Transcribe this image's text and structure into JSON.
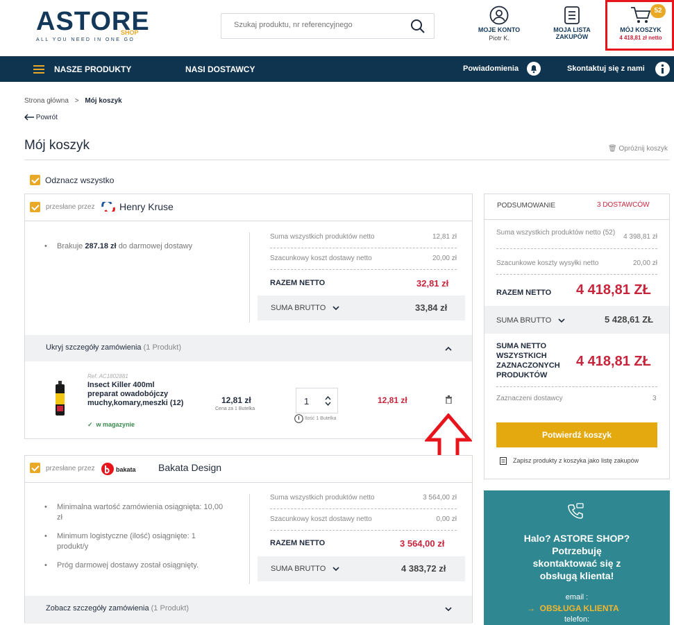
{
  "header": {
    "logo": "ASTORE",
    "logo_sub": "SHOP",
    "tagline": "ALL YOU NEED IN ONE GO",
    "search_placeholder": "Szukaj produktu, nr referencyjnego",
    "account_label": "MOJE KONTO",
    "account_user": "Piotr K.",
    "list_label_1": "MOJA LISTA",
    "list_label_2": "ZAKUPÓW",
    "cart_label": "MÓJ KOSZYK",
    "cart_total": "4 418,81 zł netto",
    "cart_count": "52"
  },
  "nav": {
    "products": "NASZE PRODUKTY",
    "suppliers": "NASI DOSTAWCY",
    "notifications": "Powiadomienia",
    "contact": "Skontaktuj się z nami"
  },
  "breadcrumb": {
    "home": "Strona główna",
    "sep": ">",
    "current": "Mój koszyk"
  },
  "back": "Powrót",
  "page_title": "Mój koszyk",
  "empty_cart": "Opróżnij koszyk",
  "deselect_all": "Odznacz wszystko",
  "sent_by": "przesłane przez",
  "supplier1": {
    "name": "Henry Kruse",
    "note_pre": "Brakuje",
    "note_amount": "287.18 zł",
    "note_post": "do darmowej dostawy",
    "sum_label": "Suma wszystkich produktów netto",
    "sum_value": "12,81 zł",
    "ship_label": "Szacunkowy koszt dostawy netto",
    "ship_value": "20,00 zł",
    "netto_label": "RAZEM NETTO",
    "netto_value": "32,81 zł",
    "brutto_label": "SUMA BRUTTO",
    "brutto_value": "33,84 zł",
    "details_label": "Ukryj szczegóły zamówienia",
    "details_count": "(1 Produkt)",
    "product": {
      "ref": "Ref. AC1802881",
      "name": "Insect Killer 400ml preparat owadobójczy muchy,komary,meszki (12)",
      "stock": "w magazynie",
      "price": "12,81 zł",
      "price_unit": "Cena za 1 Butelka",
      "qty": "1",
      "qty_note": "Ilość 1 Butelka",
      "total": "12,81 zł"
    }
  },
  "supplier2": {
    "name": "Bakata Design",
    "logo_text": "bakata",
    "notes": [
      "Minimalna wartość zamówienia osiągnięta: 10,00 zł",
      "Minimum logistyczne (ilość) osiągnięte: 1 produkt/y",
      "Próg darmowej dostawy został osiągnięty."
    ],
    "sum_label": "Suma wszystkich produktów netto",
    "sum_value": "3 564,00 zł",
    "ship_label": "Szacunkowy koszt dostawy netto",
    "ship_value": "0,00 zł",
    "netto_label": "RAZEM NETTO",
    "netto_value": "3 564,00 zł",
    "brutto_label": "SUMA BRUTTO",
    "brutto_value": "4 383,72 zł",
    "details_label": "Zobacz szczegóły zamówienia",
    "details_count": "(1 Produkt)"
  },
  "summary": {
    "title": "PODSUMOWANIE",
    "suppliers": "3 DOSTAWCÓW",
    "sum_label": "Suma wszystkich produktów netto (52)",
    "sum_value": "4 398,81 zł",
    "ship_label": "Szacunkowe koszty wysyłki netto",
    "ship_value": "20,00 zł",
    "netto_label": "RAZEM NETTO",
    "netto_value": "4 418,81 ZŁ",
    "brutto_label": "SUMA BRUTTO",
    "brutto_value": "5 428,61 ZŁ",
    "selected_label": "SUMA NETTO WSZYSTKICH ZAZNACZONYCH PRODUKTÓW",
    "selected_value": "4 418,81 ZŁ",
    "sel_suppliers_label": "Zaznaczeni dostawcy",
    "sel_suppliers_value": "3",
    "confirm": "Potwierdź koszyk",
    "save_list": "Zapisz produkty z koszyka jako listę zakupów"
  },
  "help": {
    "text": "Halo? ASTORE SHOP? Potrzebuję skontaktować się z obsługą klienta!",
    "email_label": "email :",
    "link": "OBSŁUGA KLIENTA",
    "phone_label": "telefon:"
  },
  "colors": {
    "navy": "#0f3450",
    "accent": "#e9a825",
    "red": "#c8243b",
    "teal": "#2f8791",
    "highlight": "#e8141b"
  }
}
